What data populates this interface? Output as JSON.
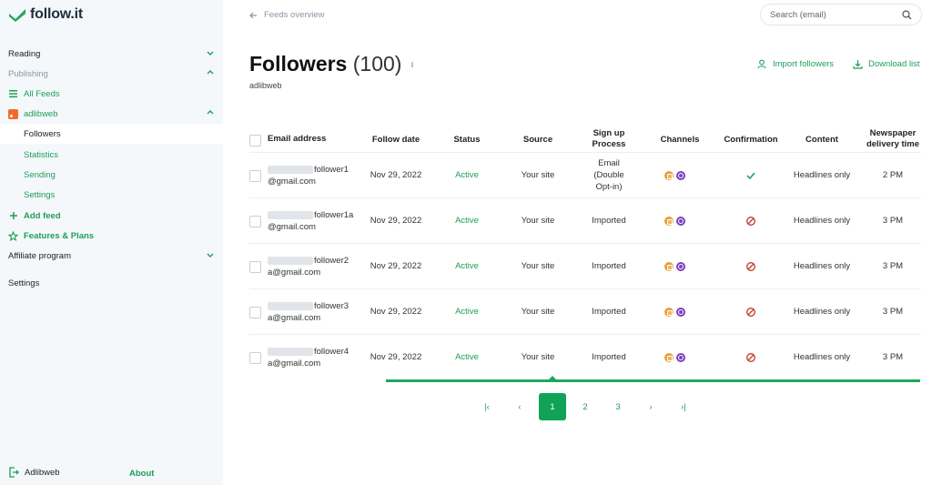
{
  "app": {
    "logo_text": "follow.it"
  },
  "sidebar": {
    "reading": "Reading",
    "publishing": "Publishing",
    "all_feeds": "All Feeds",
    "feed_name": "adlibweb",
    "followers": "Followers",
    "statistics": "Statistics",
    "sending": "Sending",
    "settings_sub": "Settings",
    "add_feed": "Add feed",
    "features": "Features & Plans",
    "affiliate": "Affiliate program",
    "settings": "Settings",
    "user": "Adlibweb",
    "about": "About"
  },
  "header": {
    "breadcrumb": "Feeds overview",
    "search_placeholder": "Search (email)"
  },
  "page": {
    "title": "Followers",
    "count": "(100)",
    "info": "i",
    "subtitle": "adlibweb",
    "import_label": "Import followers",
    "download_label": "Download list"
  },
  "table": {
    "columns": {
      "email": "Email address",
      "date": "Follow date",
      "status": "Status",
      "source": "Source",
      "signup_1": "Sign up",
      "signup_2": "Process",
      "channels": "Channels",
      "confirmation": "Confirmation",
      "content": "Content",
      "delivery_1": "Newspaper",
      "delivery_2": "delivery time"
    },
    "rows": [
      {
        "email_1": "follower1",
        "email_2": "@gmail.com",
        "date": "Nov 29, 2022",
        "status": "Active",
        "source": "Your site",
        "signup_1": "Email",
        "signup_2": "(Double",
        "signup_3": "Opt-in)",
        "confirmed": true,
        "content": "Headlines only",
        "delivery": "2 PM"
      },
      {
        "email_1": "follower1a",
        "email_2": "@gmail.com",
        "date": "Nov 29, 2022",
        "status": "Active",
        "source": "Your site",
        "signup_1": "Imported",
        "confirmed": false,
        "content": "Headlines only",
        "delivery": "3 PM"
      },
      {
        "email_1": "follower2",
        "email_2": "a@gmail.com",
        "date": "Nov 29, 2022",
        "status": "Active",
        "source": "Your site",
        "signup_1": "Imported",
        "confirmed": false,
        "content": "Headlines only",
        "delivery": "3 PM"
      },
      {
        "email_1": "follower3",
        "email_2": "a@gmail.com",
        "date": "Nov 29, 2022",
        "status": "Active",
        "source": "Your site",
        "signup_1": "Imported",
        "confirmed": false,
        "content": "Headlines only",
        "delivery": "3 PM"
      },
      {
        "email_1": "follower4",
        "email_2": "a@gmail.com",
        "date": "Nov 29, 2022",
        "status": "Active",
        "source": "Your site",
        "signup_1": "Imported",
        "confirmed": false,
        "content": "Headlines only",
        "delivery": "3 PM"
      }
    ]
  },
  "pagination": {
    "first": "|‹",
    "prev": "‹",
    "pages": [
      "1",
      "2",
      "3"
    ],
    "next": "›",
    "last": "›|"
  },
  "colors": {
    "accent": "#1e9e57",
    "sidebar_bg": "#f4f8fb",
    "rss": "#ef6c2c",
    "deny": "#c0392b"
  }
}
